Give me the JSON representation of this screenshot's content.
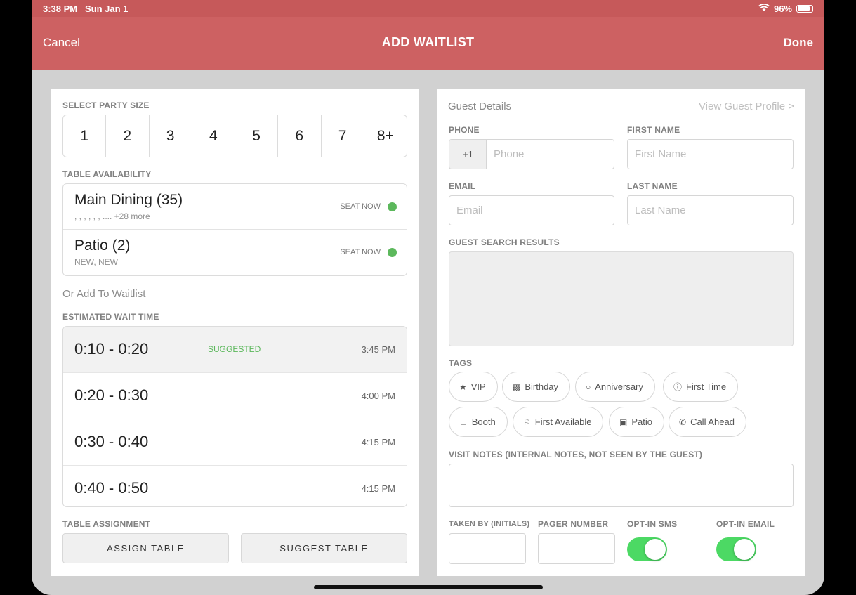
{
  "status": {
    "time": "3:38 PM",
    "date": "Sun Jan 1",
    "battery": "96%"
  },
  "nav": {
    "cancel": "Cancel",
    "title": "ADD WAITLIST",
    "done": "Done"
  },
  "left": {
    "party_label": "SELECT PARTY SIZE",
    "party_sizes": [
      "1",
      "2",
      "3",
      "4",
      "5",
      "6",
      "7",
      "8+"
    ],
    "avail_label": "TABLE AVAILABILITY",
    "areas": [
      {
        "name": "Main Dining (35)",
        "sub": ", , , , , ,  .... +28 more",
        "status": "SEAT NOW"
      },
      {
        "name": "Patio (2)",
        "sub": "NEW, NEW",
        "status": "SEAT NOW"
      }
    ],
    "or_add": "Or Add To Waitlist",
    "wait_label": "ESTIMATED WAIT TIME",
    "waits": [
      {
        "range": "0:10 - 0:20",
        "tag": "SUGGESTED",
        "time": "3:45 PM"
      },
      {
        "range": "0:20 - 0:30",
        "tag": "",
        "time": "4:00 PM"
      },
      {
        "range": "0:30 - 0:40",
        "tag": "",
        "time": "4:15 PM"
      },
      {
        "range": "0:40 - 0:50",
        "tag": "",
        "time": "4:15 PM"
      }
    ],
    "assign_label": "TABLE ASSIGNMENT",
    "assign_btn": "ASSIGN TABLE",
    "suggest_btn": "SUGGEST TABLE"
  },
  "right": {
    "title": "Guest Details",
    "view_profile": "View Guest Profile >",
    "phone_label": "PHONE",
    "phone_prefix": "+1",
    "phone_placeholder": "Phone",
    "first_label": "FIRST NAME",
    "first_placeholder": "First Name",
    "email_label": "EMAIL",
    "email_placeholder": "Email",
    "last_label": "LAST NAME",
    "last_placeholder": "Last Name",
    "results_label": "GUEST SEARCH RESULTS",
    "tags_label": "TAGS",
    "tags": [
      "VIP",
      "Birthday",
      "Anniversary",
      "First Time",
      "Booth",
      "First Available",
      "Patio",
      "Call Ahead"
    ],
    "notes_label": "VISIT NOTES (INTERNAL NOTES, NOT SEEN BY THE GUEST)",
    "taken_label": "TAKEN BY (INITIALS)",
    "pager_label": "PAGER NUMBER",
    "sms_label": "OPT-IN SMS",
    "email_opt_label": "OPT-IN EMAIL",
    "sms_on": true,
    "email_on": true
  }
}
